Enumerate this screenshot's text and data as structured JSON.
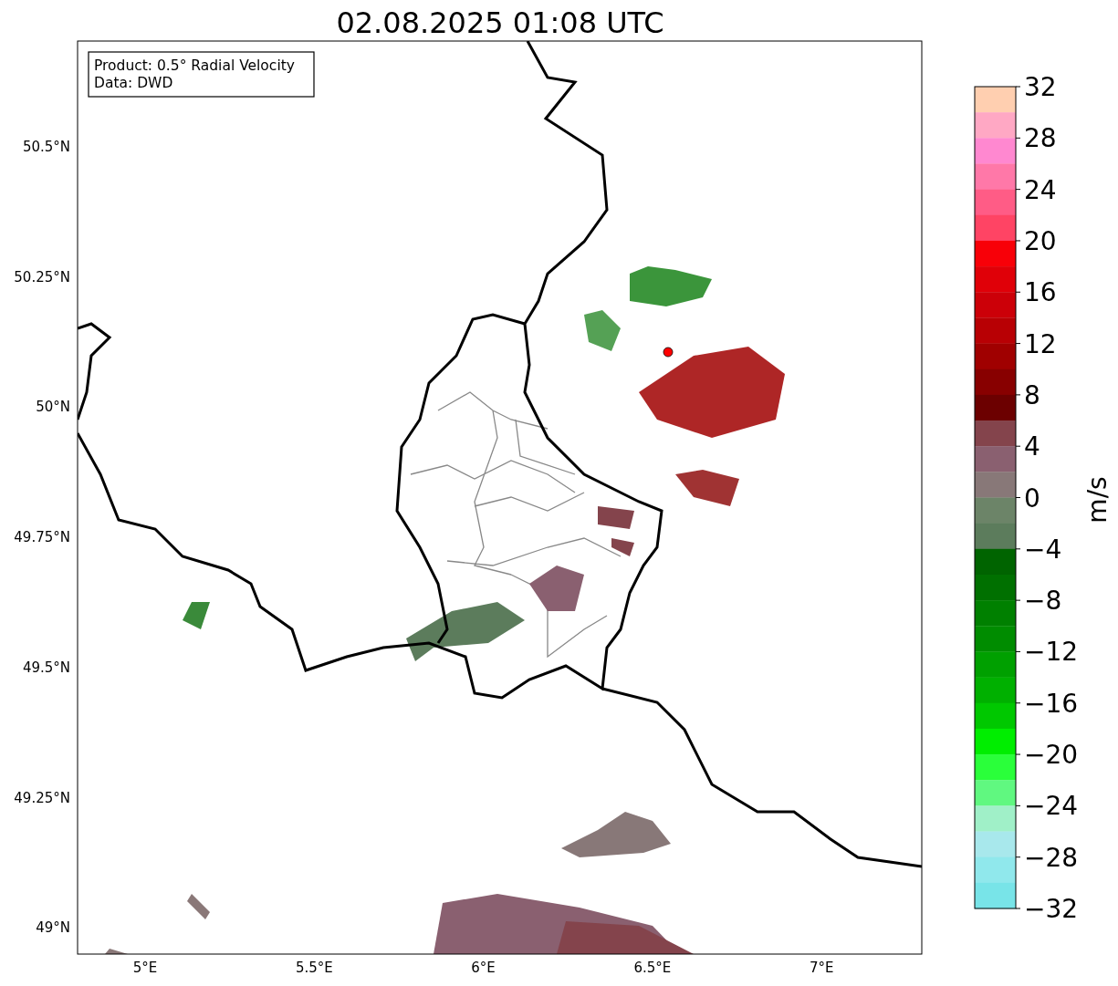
{
  "title": "02.08.2025 01:08 UTC",
  "info_box": [
    "Product: 0.5° Radial Velocity",
    "Data: DWD"
  ],
  "x_ticks": [
    "5°E",
    "5.5°E",
    "6°E",
    "6.5°E",
    "7°E"
  ],
  "y_ticks": [
    "50.5°N",
    "50.25°N",
    "50°N",
    "49.75°N",
    "49.5°N",
    "49.25°N",
    "49°N"
  ],
  "colorbar": {
    "label": "m/s",
    "ticks": [
      "32",
      "28",
      "24",
      "20",
      "16",
      "12",
      "8",
      "4",
      "0",
      "−4",
      "−8",
      "−12",
      "−16",
      "−20",
      "−24",
      "−28",
      "−32"
    ],
    "segments": [
      {
        "color": "#ffcfb0"
      },
      {
        "color": "#ffa8c4"
      },
      {
        "color": "#ff88d0"
      },
      {
        "color": "#ff78a8"
      },
      {
        "color": "#ff5c86"
      },
      {
        "color": "#ff4464"
      },
      {
        "color": "#f80008"
      },
      {
        "color": "#e00008"
      },
      {
        "color": "#cc0008"
      },
      {
        "color": "#b80004"
      },
      {
        "color": "#a00000"
      },
      {
        "color": "#880000"
      },
      {
        "color": "#6c0000"
      },
      {
        "color": "#84444c"
      },
      {
        "color": "#8a6070"
      },
      {
        "color": "#887878"
      },
      {
        "color": "#6c8468"
      },
      {
        "color": "#5c7c5c"
      },
      {
        "color": "#006400"
      },
      {
        "color": "#007000"
      },
      {
        "color": "#008000"
      },
      {
        "color": "#008c00"
      },
      {
        "color": "#00a000"
      },
      {
        "color": "#00b000"
      },
      {
        "color": "#00c800"
      },
      {
        "color": "#00ee00"
      },
      {
        "color": "#2aff3a"
      },
      {
        "color": "#60f880"
      },
      {
        "color": "#a0f0c8"
      },
      {
        "color": "#a8e8ec"
      },
      {
        "color": "#90e8ec"
      },
      {
        "color": "#78e4e8"
      }
    ]
  }
}
